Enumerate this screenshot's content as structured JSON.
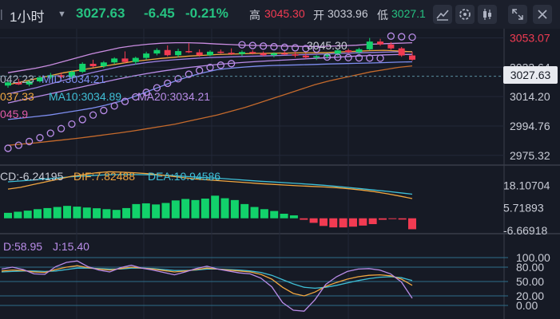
{
  "toolbar": {
    "interval": "1小时",
    "price": "3027.63",
    "change": "-6.45",
    "change_pct": "-0.21%",
    "high_label": "高",
    "high_value": "3045.30",
    "open_label": "开",
    "open_value": "3033.96",
    "low_label": "低",
    "low_value": "3027.1",
    "icons": [
      "dropdown-caret-icon",
      "indicator-icon",
      "settings-icon",
      "candle-style-icon",
      "expand-icon",
      "close-icon"
    ]
  },
  "colors": {
    "up": "#12d26b",
    "down": "#f23b52",
    "accent": "#3ab0a8",
    "bg": "#161a25"
  },
  "chart_data": [
    {
      "type": "line",
      "name": "price-panel",
      "y_tick_labels": [
        "3053.07",
        "3033.64",
        "3014.20",
        "2994.76",
        "2975.32"
      ],
      "y_ticks": [
        3053.07,
        3033.64,
        3014.2,
        2994.76,
        2975.32
      ],
      "ylim": [
        2971,
        3057
      ],
      "current_price": "3027.63",
      "high_annotation": "3045.30",
      "legend_texts": [
        "042.23",
        "MID:3034.21",
        "037.33",
        "MA10:3034.89",
        "MA20:3034.21",
        "045.9"
      ],
      "candles": [
        [
          3021.5,
          3024.8,
          3020.1,
          3023.6
        ],
        [
          3023.6,
          3026.0,
          3021.9,
          3022.2
        ],
        [
          3022.2,
          3025.1,
          3021.0,
          3024.3
        ],
        [
          3024.3,
          3027.9,
          3023.5,
          3026.9
        ],
        [
          3026.9,
          3029.8,
          3025.7,
          3028.4
        ],
        [
          3028.4,
          3030.2,
          3026.1,
          3027.0
        ],
        [
          3027.0,
          3031.5,
          3026.3,
          3030.6
        ],
        [
          3030.6,
          3036.9,
          3029.8,
          3035.9
        ],
        [
          3035.9,
          3038.6,
          3033.4,
          3034.3
        ],
        [
          3034.3,
          3037.7,
          3033.1,
          3036.8
        ],
        [
          3036.8,
          3040.2,
          3035.6,
          3039.4
        ],
        [
          3039.4,
          3044.1,
          3036.2,
          3037.1
        ],
        [
          3037.1,
          3040.6,
          3035.4,
          3039.8
        ],
        [
          3039.8,
          3043.9,
          3038.6,
          3042.7
        ],
        [
          3042.7,
          3046.2,
          3041.5,
          3045.0
        ],
        [
          3045.0,
          3048.1,
          3040.8,
          3041.6
        ],
        [
          3041.6,
          3045.9,
          3040.2,
          3044.3
        ],
        [
          3044.3,
          3049.5,
          3043.0,
          3043.5
        ],
        [
          3043.5,
          3045.4,
          3040.6,
          3041.6
        ],
        [
          3041.6,
          3044.8,
          3040.9,
          3043.9
        ],
        [
          3043.9,
          3045.3,
          3042.6,
          3043.2
        ],
        [
          3043.2,
          3046.1,
          3041.7,
          3042.4
        ],
        [
          3042.4,
          3044.7,
          3041.1,
          3043.7
        ],
        [
          3043.7,
          3045.0,
          3042.1,
          3042.9
        ],
        [
          3042.9,
          3044.1,
          3040.8,
          3041.6
        ],
        [
          3041.6,
          3043.5,
          3040.2,
          3042.9
        ],
        [
          3042.9,
          3044.6,
          3041.6,
          3042.2
        ],
        [
          3042.2,
          3043.8,
          3040.1,
          3041.3
        ],
        [
          3041.3,
          3042.9,
          3039.2,
          3040.1
        ],
        [
          3040.1,
          3041.6,
          3038.4,
          3040.9
        ],
        [
          3040.9,
          3043.0,
          3039.5,
          3042.5
        ],
        [
          3042.5,
          3045.3,
          3041.2,
          3044.8
        ],
        [
          3044.8,
          3045.9,
          3042.9,
          3043.6
        ],
        [
          3043.6,
          3046.5,
          3042.4,
          3045.5
        ],
        [
          3045.5,
          3053.0,
          3044.7,
          3050.6
        ],
        [
          3050.6,
          3052.4,
          3047.8,
          3048.7
        ],
        [
          3048.7,
          3050.3,
          3045.2,
          3046.1
        ],
        [
          3046.1,
          3047.0,
          3040.5,
          3041.4
        ],
        [
          3041.4,
          3043.8,
          3037.9,
          3038.6
        ]
      ],
      "boll_upper": [
        3030.0,
        3031.5,
        3033.0,
        3035.0,
        3037.5,
        3040.0,
        3042.5,
        3044.5,
        3046.5,
        3047.8,
        3048.8,
        3049.5,
        3049.8,
        3049.8,
        3049.5,
        3049.0,
        3048.6,
        3048.2,
        3048.0,
        3047.8,
        3047.6,
        3047.4,
        3047.3,
        3047.5,
        3047.8,
        3048.2,
        3048.8,
        3049.2,
        3049.5,
        3049.8
      ],
      "boll_mid": [
        3016.0,
        3018.0,
        3020.0,
        3022.5,
        3025.0,
        3027.5,
        3030.0,
        3032.0,
        3034.0,
        3035.5,
        3036.8,
        3037.8,
        3038.6,
        3039.2,
        3039.8,
        3040.2,
        3040.5,
        3040.8,
        3041.0,
        3041.3,
        3041.6,
        3041.9,
        3042.2,
        3042.5,
        3042.8,
        3043.1,
        3043.4,
        3043.6,
        3043.8,
        3043.9
      ],
      "boll_lower": [
        2999.0,
        3000.0,
        3001.0,
        3002.0,
        3003.5,
        3005.0,
        3006.5,
        3008.5,
        3011.0,
        3014.0,
        3017.5,
        3021.0,
        3024.5,
        3027.5,
        3030.0,
        3032.0,
        3033.0,
        3033.8,
        3034.4,
        3034.8,
        3035.0,
        3035.2,
        3035.5,
        3035.8,
        3036.0,
        3036.2,
        3036.4,
        3036.7,
        3037.0,
        3037.2
      ],
      "ma10": [
        3022.0,
        3024.0,
        3026.0,
        3028.0,
        3030.0,
        3031.5,
        3033.0,
        3034.5,
        3036.0,
        3037.5,
        3038.5,
        3039.5,
        3040.3,
        3041.0,
        3041.5,
        3042.0,
        3042.3,
        3042.6,
        3042.8,
        3042.9,
        3043.0,
        3043.1,
        3043.2,
        3043.4,
        3043.8,
        3044.2,
        3044.6,
        3044.8,
        3044.4,
        3043.8
      ],
      "ma20": [
        3010.0,
        3012.0,
        3014.0,
        3016.0,
        3018.0,
        3020.0,
        3022.0,
        3024.0,
        3026.0,
        3027.8,
        3029.5,
        3031.0,
        3032.3,
        3033.5,
        3034.5,
        3035.4,
        3036.2,
        3036.9,
        3037.5,
        3038.0,
        3038.5,
        3039.0,
        3039.5,
        3040.0,
        3040.5,
        3041.0,
        3041.4,
        3041.8,
        3042.0,
        3042.1
      ],
      "ma60": [
        2982.0,
        2982.8,
        2983.6,
        2984.6,
        2985.6,
        2986.6,
        2987.8,
        2989.0,
        2990.2,
        2991.5,
        2993.0,
        2994.5,
        2996.0,
        2998.0,
        3000.0,
        3002.0,
        3004.5,
        3007.0,
        3010.0,
        3013.0,
        3016.0,
        3019.0,
        3022.0,
        3024.5,
        3026.5,
        3028.5,
        3030.5,
        3032.0,
        3033.5,
        3034.5
      ],
      "sar": [
        [
          0,
          2980.0
        ],
        [
          1,
          2982.0
        ],
        [
          2,
          2984.5
        ],
        [
          3,
          2987.0
        ],
        [
          4,
          2990.0
        ],
        [
          5,
          2993.0
        ],
        [
          6,
          2996.0
        ],
        [
          7,
          2999.0
        ],
        [
          8,
          3002.0
        ],
        [
          9,
          3005.0
        ],
        [
          10,
          3008.0
        ],
        [
          11,
          3011.0
        ],
        [
          12,
          3014.0
        ],
        [
          13,
          3017.0
        ],
        [
          14,
          3020.0
        ],
        [
          15,
          3023.0
        ],
        [
          16,
          3026.0
        ],
        [
          17,
          3029.0
        ],
        [
          18,
          3031.5
        ],
        [
          19,
          3033.5
        ],
        [
          20,
          3035.0
        ],
        [
          21,
          3036.0
        ],
        [
          22,
          3048.5
        ],
        [
          23,
          3048.0
        ],
        [
          24,
          3047.6
        ],
        [
          25,
          3047.2
        ],
        [
          26,
          3046.8
        ],
        [
          27,
          3046.5
        ],
        [
          28,
          3046.0
        ],
        [
          29,
          3045.6
        ],
        [
          30,
          3040.4
        ],
        [
          31,
          3040.2
        ],
        [
          32,
          3040.0
        ],
        [
          33,
          3039.8
        ],
        [
          34,
          3039.7
        ],
        [
          35,
          3039.6
        ],
        [
          36,
          3054.2
        ],
        [
          37,
          3053.8
        ],
        [
          38,
          3053.5
        ]
      ]
    },
    {
      "type": "bar",
      "name": "macd-panel",
      "legend": [
        "CD:-6.24195",
        "DIF:7.82488",
        "DEA:10.94586"
      ],
      "y_tick_labels": [
        "18.10704",
        "5.71893",
        "-6.66918"
      ],
      "y_ticks": [
        18.10704,
        5.71893,
        -6.66918
      ],
      "ylim": [
        -8,
        27
      ],
      "histogram": [
        3.0,
        3.6,
        4.2,
        5.0,
        5.6,
        6.2,
        6.8,
        6.4,
        5.9,
        5.5,
        5.0,
        4.6,
        5.6,
        7.8,
        8.2,
        7.6,
        8.4,
        9.8,
        10.6,
        10.0,
        10.8,
        12.4,
        11.0,
        10.0,
        7.8,
        6.2,
        5.0,
        4.0,
        2.5,
        1.6,
        -0.8,
        -2.5,
        -4.2,
        -5.0,
        -5.0,
        -4.6,
        -4.0,
        -3.2,
        -0.8,
        -0.4,
        -0.7,
        -6.0
      ],
      "dif": [
        16,
        17,
        18.5,
        20,
        21.5,
        23,
        24,
        25,
        25.5,
        25.3,
        25,
        24.5,
        23.8,
        23,
        22.2,
        21.5,
        21,
        20.5,
        20,
        19.5,
        19,
        18.6,
        18.2,
        17.8,
        17.5,
        17.2,
        16.8,
        16.2,
        15.5,
        14.6,
        13.5,
        12.2,
        10.8
      ],
      "dea": [
        20,
        20.5,
        21,
        21.6,
        22.2,
        22.8,
        23.2,
        23.6,
        23.9,
        24,
        24,
        23.9,
        23.7,
        23.4,
        23,
        22.6,
        22.2,
        21.8,
        21.3,
        20.8,
        20.3,
        19.9,
        19.5,
        19.1,
        18.6,
        18.1,
        17.5,
        16.9,
        16.2,
        15.5,
        14.8,
        14.0,
        13.2
      ]
    },
    {
      "type": "line",
      "name": "kdj-panel",
      "legend": [
        "D:58.95",
        "J:15.40"
      ],
      "y_tick_labels": [
        "100.00",
        "80.00",
        "50.00",
        "20.00",
        "0.00"
      ],
      "y_ticks": [
        100,
        80,
        50,
        20,
        0
      ],
      "ylim": [
        -5,
        105
      ],
      "k": [
        72,
        74,
        73,
        70,
        69,
        75,
        80,
        83,
        79,
        76,
        74,
        77,
        80,
        78,
        76,
        73,
        70,
        72,
        75,
        78,
        76,
        74,
        72,
        70,
        65,
        55,
        38,
        25,
        20,
        28,
        40,
        48,
        55,
        60,
        63,
        64,
        62,
        55,
        42
      ],
      "d": [
        70,
        71,
        72,
        72,
        71,
        72,
        75,
        78,
        78,
        77,
        76,
        76,
        78,
        78,
        77,
        75,
        73,
        73,
        74,
        76,
        76,
        75,
        74,
        72,
        69,
        63,
        54,
        45,
        38,
        36,
        38,
        42,
        47,
        52,
        56,
        59,
        60,
        58,
        52
      ],
      "j": [
        76,
        80,
        75,
        66,
        65,
        81,
        90,
        93,
        81,
        74,
        70,
        79,
        84,
        78,
        74,
        69,
        64,
        70,
        77,
        82,
        76,
        72,
        68,
        66,
        57,
        39,
        6,
        -10,
        -12,
        12,
        44,
        60,
        71,
        76,
        77,
        74,
        66,
        49,
        15
      ]
    }
  ]
}
